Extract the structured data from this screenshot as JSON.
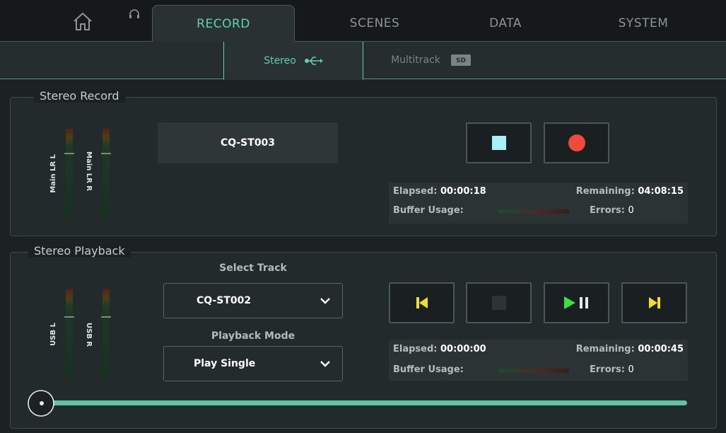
{
  "tabs": [
    {
      "label": "RECORD",
      "active": true
    },
    {
      "label": "SCENES"
    },
    {
      "label": "DATA"
    },
    {
      "label": "SYSTEM"
    }
  ],
  "icons": {
    "home": "home-icon",
    "headphones": "headphones-icon",
    "usb": "usb-icon",
    "sd": "sd-card-icon"
  },
  "subtabs": [
    {
      "label": "Stereo",
      "active": true
    },
    {
      "label": "Multitrack"
    }
  ],
  "record": {
    "title": "Stereo Record",
    "meters": [
      "Main LR L",
      "Main LR R"
    ],
    "file_name": "CQ-ST003",
    "elapsed_label": "Elapsed:",
    "elapsed": "00:00:18",
    "remaining_label": "Remaining:",
    "remaining": "04:08:15",
    "buffer_label": "Buffer Usage:",
    "errors_label": "Errors:",
    "errors": "0"
  },
  "playback": {
    "title": "Stereo Playback",
    "meters": [
      "USB L",
      "USB R"
    ],
    "select_track_label": "Select Track",
    "track": "CQ-ST002",
    "mode_label": "Playback Mode",
    "mode": "Play Single",
    "elapsed_label": "Elapsed:",
    "elapsed": "00:00:00",
    "remaining_label": "Remaining:",
    "remaining": "00:00:45",
    "buffer_label": "Buffer Usage:",
    "errors_label": "Errors:",
    "errors": "0",
    "position": 0
  },
  "colors": {
    "accent": "#5fd0b0",
    "record": "#f04a3a",
    "stop": "#a8f0f8",
    "transport": "#f0e020",
    "play": "#3ce040"
  }
}
